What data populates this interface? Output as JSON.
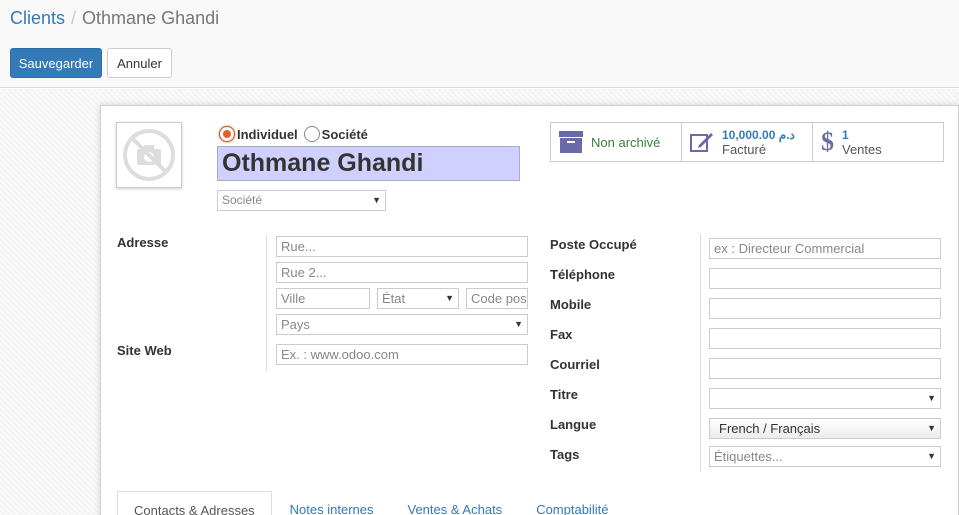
{
  "breadcrumb": {
    "parent": "Clients",
    "separator": "/",
    "current": "Othmane Ghandi"
  },
  "toolbar": {
    "save_label": "Sauvegarder",
    "cancel_label": "Annuler"
  },
  "partner_type": {
    "individual_label": "Individuel",
    "company_label": "Société",
    "selected": "Individuel"
  },
  "name": "Othmane Ghandi",
  "company": {
    "placeholder": "Société"
  },
  "stats": {
    "archive_label": "Non archivé",
    "invoiced_value": "10,000.00 د.م",
    "invoiced_label": "Facturé",
    "sales_value": "1",
    "sales_label": "Ventes"
  },
  "address": {
    "label": "Adresse",
    "street_placeholder": "Rue...",
    "street2_placeholder": "Rue 2...",
    "city_placeholder": "Ville",
    "state_placeholder": "État",
    "zip_placeholder": "Code pos",
    "country_placeholder": "Pays"
  },
  "website": {
    "label": "Site Web",
    "placeholder": "Ex. : www.odoo.com"
  },
  "right_fields": {
    "job_label": "Poste Occupé",
    "job_placeholder": "ex : Directeur Commercial",
    "phone_label": "Téléphone",
    "mobile_label": "Mobile",
    "fax_label": "Fax",
    "email_label": "Courriel",
    "title_label": "Titre",
    "lang_label": "Langue",
    "lang_value": "French / Français",
    "tags_label": "Tags",
    "tags_placeholder": "Étiquettes..."
  },
  "tabs": [
    "Contacts & Adresses",
    "Notes internes",
    "Ventes & Achats",
    "Comptabilité"
  ],
  "colors": {
    "primary": "#337ab7",
    "name_bg": "#d0d0ff",
    "archive_green": "#3c7d3c",
    "stat_icon": "#6a6aa8"
  }
}
